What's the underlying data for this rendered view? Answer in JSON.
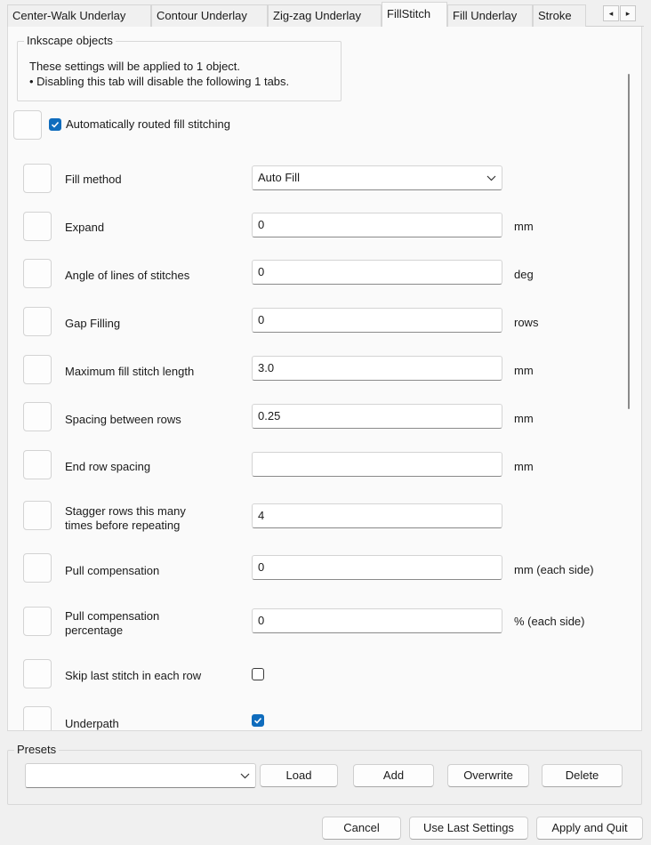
{
  "tabs": {
    "items": [
      {
        "label": "Center-Walk Underlay",
        "active": false
      },
      {
        "label": "Contour Underlay",
        "active": false
      },
      {
        "label": "Zig-zag Underlay",
        "active": false
      },
      {
        "label": "FillStitch",
        "active": true
      },
      {
        "label": "Fill Underlay",
        "active": false
      },
      {
        "label": "Stroke",
        "active": false
      }
    ],
    "scroll_left_icon": "◂",
    "scroll_right_icon": "▸"
  },
  "objects_group": {
    "title": "Inkscape objects",
    "line1": "These settings will be applied to 1 object.",
    "line2": "• Disabling this tab will disable the following 1 tabs."
  },
  "auto_route": {
    "label": "Automatically routed fill stitching",
    "checked": true
  },
  "params": [
    {
      "label": "Fill method",
      "type": "select",
      "value": "Auto Fill",
      "unit": ""
    },
    {
      "label": "Expand",
      "type": "text",
      "value": "0",
      "unit": "mm"
    },
    {
      "label": "Angle of lines of stitches",
      "type": "text",
      "value": "0",
      "unit": "deg"
    },
    {
      "label": "Gap Filling",
      "type": "text",
      "value": "0",
      "unit": "rows"
    },
    {
      "label": "Maximum fill stitch length",
      "type": "text",
      "value": "3.0",
      "unit": "mm"
    },
    {
      "label": "Spacing between rows",
      "type": "text",
      "value": "0.25",
      "unit": "mm"
    },
    {
      "label": "End row spacing",
      "type": "text",
      "value": "",
      "unit": "mm"
    },
    {
      "label": "Stagger rows this many times before repeating",
      "label_line1": "Stagger rows this many",
      "label_line2": "times before repeating",
      "type": "text",
      "value": "4",
      "unit": ""
    },
    {
      "label": "Pull compensation",
      "type": "text",
      "value": "0",
      "unit": "mm (each side)"
    },
    {
      "label": "Pull compensation percentage",
      "label_line1": "Pull compensation",
      "label_line2": "percentage",
      "type": "text",
      "value": "0",
      "unit": "% (each side)"
    },
    {
      "label": "Skip last stitch in each row",
      "type": "checkbox",
      "checked": false
    },
    {
      "label": "Underpath",
      "type": "checkbox",
      "checked": true
    }
  ],
  "presets": {
    "title": "Presets",
    "selected": "",
    "load_label": "Load",
    "add_label": "Add",
    "overwrite_label": "Overwrite",
    "delete_label": "Delete"
  },
  "footer": {
    "cancel_label": "Cancel",
    "use_last_label": "Use Last Settings",
    "apply_quit_label": "Apply and Quit"
  },
  "colors": {
    "accent": "#0f6cbd",
    "background": "#f0f0f0",
    "panel": "#fafafa"
  }
}
